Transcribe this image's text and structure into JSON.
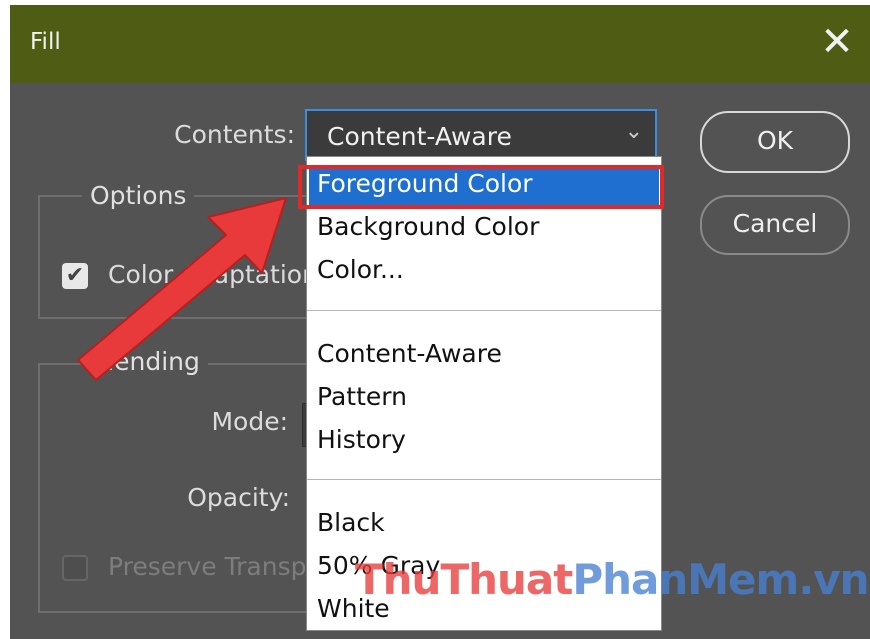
{
  "window": {
    "title": "Fill",
    "close_glyph": "✕"
  },
  "contents": {
    "label": "Contents:",
    "selected": "Content-Aware",
    "chevron_glyph": "⌄",
    "options_groups": [
      [
        "Foreground Color",
        "Background Color",
        "Color..."
      ],
      [
        "Content-Aware",
        "Pattern",
        "History"
      ],
      [
        "Black",
        "50% Gray",
        "White"
      ]
    ],
    "highlighted_option": "Foreground Color"
  },
  "buttons": {
    "ok": "OK",
    "cancel": "Cancel"
  },
  "options_group": {
    "title": "Options",
    "color_adaptation_label": "Color Adaptation",
    "color_adaptation_checked": true
  },
  "blending_group": {
    "title": "Blending",
    "mode_label": "Mode:",
    "opacity_label": "Opacity:",
    "preserve_label": "Preserve Transparency",
    "preserve_checked": false
  },
  "watermark": {
    "part1": "Thu",
    "part2": "Thuat",
    "part3": "Phan",
    "part4": "Mem",
    "part5": ".vn"
  },
  "colors": {
    "title_bar": "#4f5d14",
    "dialog_bg": "#535353",
    "selection_blue": "#1e6fd0",
    "annotation_red": "#e02a2a"
  }
}
